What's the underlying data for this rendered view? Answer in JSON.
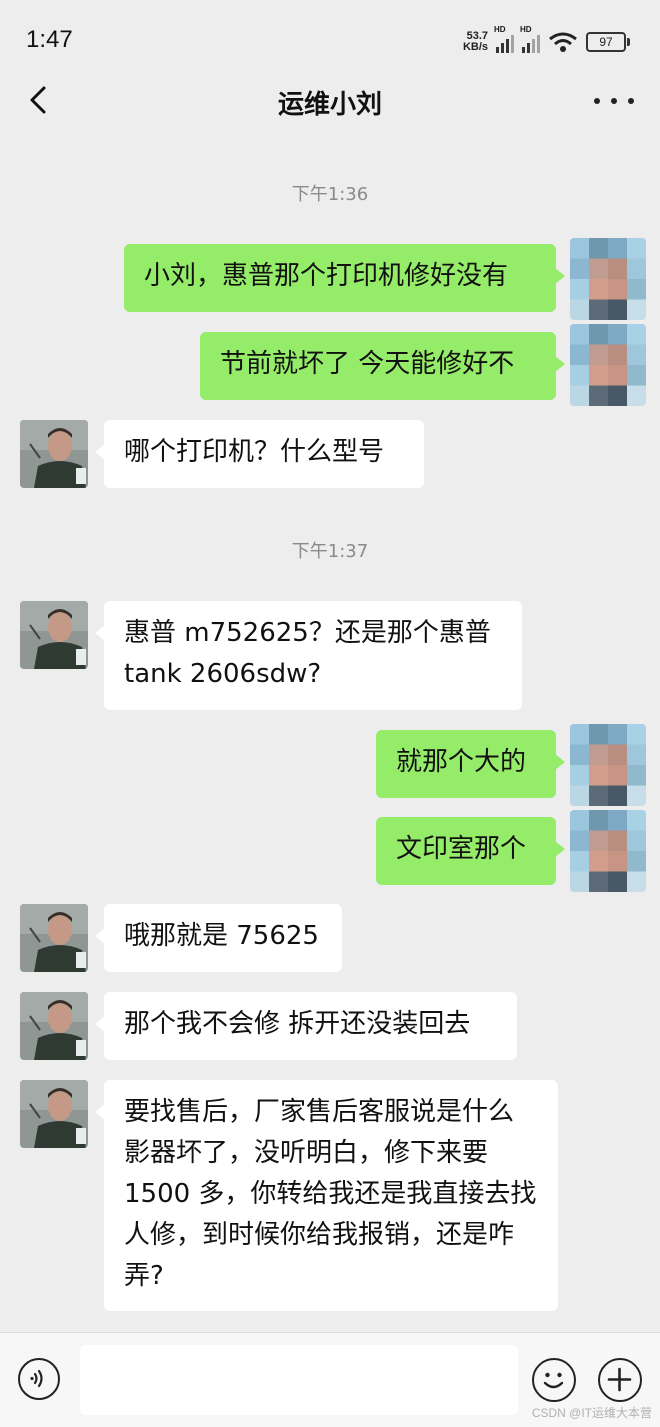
{
  "status_bar": {
    "time": "1:47",
    "net_speed_value": "53.7",
    "net_speed_unit": "KB/s",
    "signal_label_1": "HD",
    "signal_label_2": "HD",
    "battery": "97"
  },
  "header": {
    "title": "运维小刘",
    "back_icon": "chevron-left-icon",
    "more_icon": "more-dots-icon"
  },
  "messages": {
    "ts1": "下午1:36",
    "m1": "小刘，惠普那个打印机修好没有",
    "m2": "节前就坏了 今天能修好不",
    "m3": "哪个打印机？什么型号",
    "ts2": "下午1:37",
    "m4": "惠普 m752625？还是那个惠普 tank 2606sdw?",
    "m5": "就那个大的",
    "m6": "文印室那个",
    "m7": "哦那就是 75625",
    "m8": "那个我不会修 拆开还没装回去",
    "m9": "要找售后，厂家售后客服说是什么影器坏了，没听明白，修下来要 1500 多，你转给我还是我直接去找人修，到时候你给我报销，还是咋弄?"
  },
  "input_bar": {
    "voice_icon": "voice-icon",
    "emoji_icon": "emoji-icon",
    "plus_icon": "plus-icon",
    "placeholder": ""
  },
  "watermark": "CSDN @IT运维大本营",
  "colors": {
    "background": "#ededed",
    "my_bubble": "#95ec69",
    "other_bubble": "#ffffff"
  }
}
